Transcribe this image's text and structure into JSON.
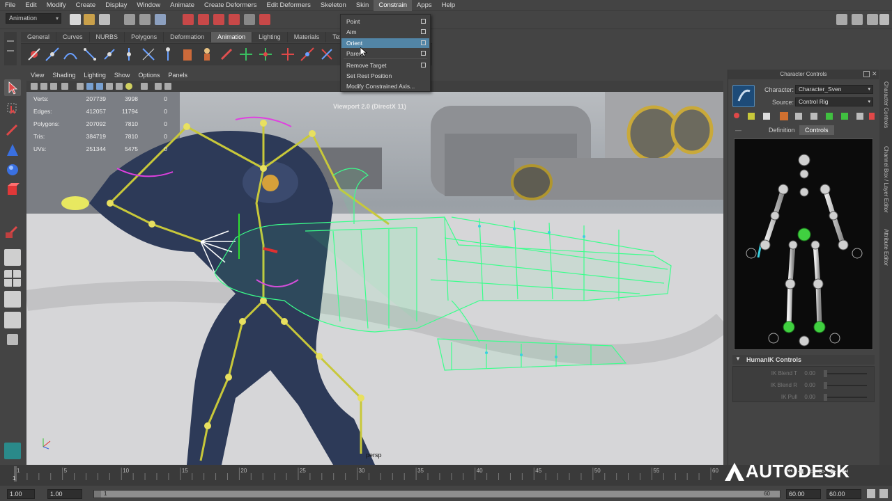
{
  "menubar": {
    "items": [
      "File",
      "Edit",
      "Modify",
      "Create",
      "Display",
      "Window",
      "Animate",
      "Create Deformers",
      "Edit Deformers",
      "Skeleton",
      "Skin",
      "Constrain",
      "Apps",
      "Help"
    ],
    "active": "Constrain"
  },
  "statusline": {
    "mode": "Animation"
  },
  "shelf": {
    "tabs": [
      "General",
      "Curves",
      "NURBS",
      "Polygons",
      "Deformation",
      "Animation",
      "Lighting",
      "Materials",
      "Text"
    ],
    "active_tab": "Animation"
  },
  "panel_menu": [
    "View",
    "Shading",
    "Lighting",
    "Show",
    "Options",
    "Panels"
  ],
  "hud": {
    "rows": [
      {
        "label": "Verts:",
        "a": "207739",
        "b": "3998",
        "c": "0"
      },
      {
        "label": "Edges:",
        "a": "412057",
        "b": "11794",
        "c": "0"
      },
      {
        "label": "Polygons:",
        "a": "207092",
        "b": "7810",
        "c": "0"
      },
      {
        "label": "Tris:",
        "a": "384719",
        "b": "7810",
        "c": "0"
      },
      {
        "label": "UVs:",
        "a": "251344",
        "b": "5475",
        "c": "0"
      }
    ]
  },
  "viewport": {
    "label": "Viewport 2.0 (DirectX 11)",
    "camera": "persp"
  },
  "constrain_menu": {
    "items": [
      {
        "label": "Point",
        "option": true
      },
      {
        "label": "Aim",
        "option": true
      },
      {
        "label": "Orient",
        "option": true,
        "highlighted": true
      },
      {
        "label": "Parent",
        "option": true
      },
      {
        "label": "Remove Target",
        "option": true
      },
      {
        "label": "Set Rest Position",
        "option": false
      },
      {
        "label": "Modify Constrained Axis...",
        "option": false
      }
    ]
  },
  "character_controls": {
    "title": "Character Controls",
    "character_label": "Character:",
    "character_value": "Character_Sven",
    "source_label": "Source:",
    "source_value": "Control Rig",
    "tabs": [
      "Definition",
      "Controls"
    ],
    "active_tab": "Controls",
    "humanik": {
      "title": "HumanIK Controls",
      "sliders": [
        {
          "label": "IK Blend T",
          "value": "0.00"
        },
        {
          "label": "IK Blend R",
          "value": "0.00"
        },
        {
          "label": "IK Pull",
          "value": "0.00"
        }
      ]
    }
  },
  "side_tabs": [
    "Character Controls",
    "Channel Box / Layer Editor",
    "Attribute Editor"
  ],
  "timeline": {
    "ticks": [
      "1",
      "5",
      "10",
      "15",
      "20",
      "25",
      "30",
      "35",
      "40",
      "45",
      "50",
      "55",
      "60"
    ]
  },
  "range": {
    "start": "1.00",
    "inner_start": "1.00",
    "inner_frame": "1",
    "inner_end": "60",
    "end_a": "60.00",
    "end_b": "60.00"
  },
  "brand": "AUTODESK",
  "colors": {
    "wire": "#3bff8c",
    "bone": "#c8c83a",
    "highlight": "#5285a6",
    "figure_node": "#cfcfcf",
    "figure_active": "#40d040"
  }
}
